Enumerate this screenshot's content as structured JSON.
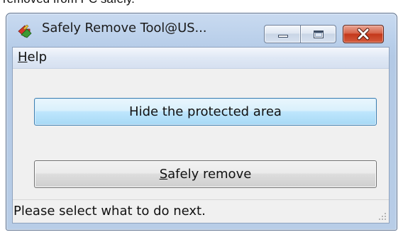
{
  "background_text": "removed from PC safely.",
  "window": {
    "title": "Safely Remove Tool@US...",
    "icon": "app-arrows-icon",
    "caption_buttons": [
      "minimize-icon",
      "maximize-icon",
      "close-icon"
    ]
  },
  "menubar": {
    "help_mnemonic": "H",
    "help_rest": "elp"
  },
  "buttons": {
    "hide_label": "Hide the protected area",
    "safe_mnemonic": "S",
    "safe_rest": "afely remove"
  },
  "status": {
    "text": "Please select what to do next."
  },
  "colors": {
    "close_button": "#c4381b",
    "focused_button": "#bee6fd"
  }
}
